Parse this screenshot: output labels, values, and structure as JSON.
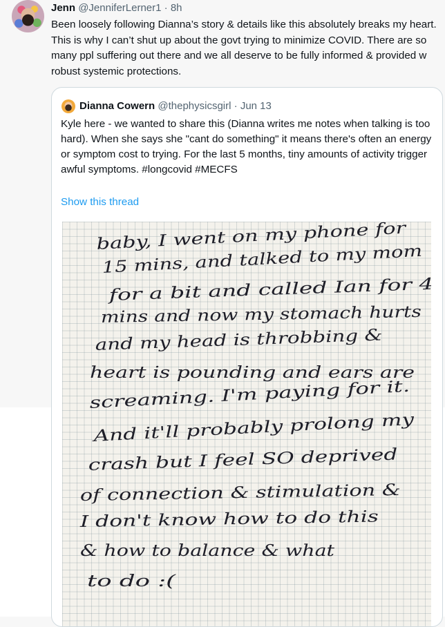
{
  "tweet": {
    "author_name": "Jenn",
    "author_handle": "@JenniferLerner1",
    "separator": "·",
    "time": "8h",
    "text": "Been loosely following Dianna’s story & details like this absolutely breaks my heart. This is why I can’t shut up about the govt trying to minimize COVID. There are so many ppl suffering out there and we all deserve to be fully informed & provided w robust systemic protections."
  },
  "quoted": {
    "author_name": "Dianna Cowern",
    "author_handle": "@thephysicsgirl",
    "separator": "·",
    "time": "Jun 13",
    "text": "Kyle here - we wanted to share this (Dianna writes me notes when talking is too hard). When she says she \"cant do something\" it means there's often an energy or symptom cost to trying. For the last 5 months, tiny amounts of activity trigger awful symptoms. #longcovid #MECFS",
    "show_thread": "Show this thread",
    "note_lines": [
      "baby, I went on my phone for",
      "15 mins, and talked to my mom",
      "for a bit and called Ian for 4",
      "mins and now my stomach hurts",
      "and my head is throbbing &",
      "heart is pounding and ears are",
      "screaming. I'm paying for it.",
      "And it'll probably prolong my",
      "crash but I feel SO deprived",
      "of connection & stimulation &",
      "I don't know how to do this",
      "& how to balance & what",
      "to do :("
    ]
  }
}
